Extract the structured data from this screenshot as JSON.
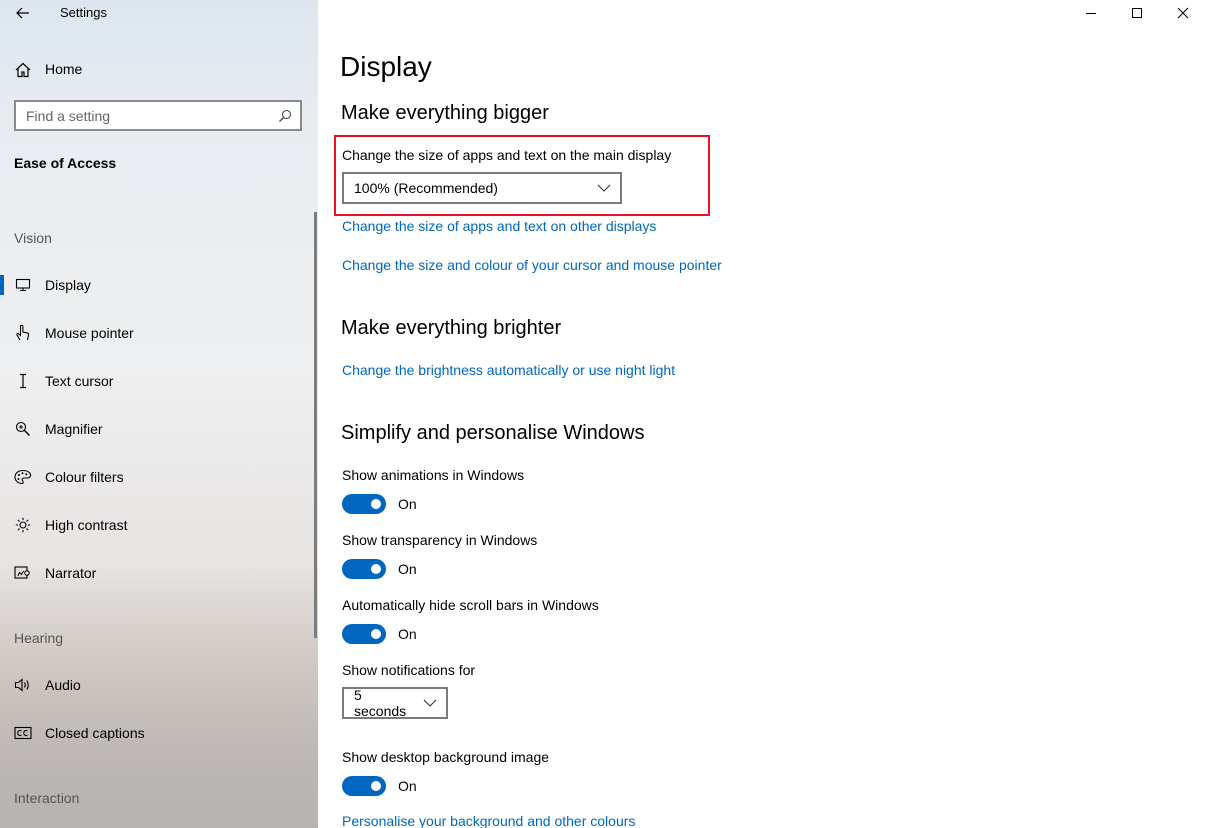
{
  "window": {
    "app_title": "Settings",
    "controls": [
      "minimize",
      "maximize",
      "close"
    ]
  },
  "sidebar": {
    "home_label": "Home",
    "search": {
      "placeholder": "Find a setting",
      "value": ""
    },
    "section_title": "Ease of Access",
    "groups": {
      "vision": "Vision",
      "hearing": "Hearing",
      "interaction": "Interaction"
    },
    "items": [
      {
        "label": "Display",
        "icon": "monitor-icon",
        "selected": true
      },
      {
        "label": "Mouse pointer",
        "icon": "mouse-pointer-icon"
      },
      {
        "label": "Text cursor",
        "icon": "text-cursor-icon"
      },
      {
        "label": "Magnifier",
        "icon": "magnifier-icon"
      },
      {
        "label": "Colour filters",
        "icon": "colour-filters-icon"
      },
      {
        "label": "High contrast",
        "icon": "high-contrast-icon"
      },
      {
        "label": "Narrator",
        "icon": "narrator-icon"
      },
      {
        "label": "Audio",
        "icon": "audio-icon"
      },
      {
        "label": "Closed captions",
        "icon": "closed-captions-icon"
      }
    ]
  },
  "main": {
    "title": "Display",
    "bigger": {
      "heading": "Make everything bigger",
      "size_label": "Change the size of apps and text on the main display",
      "size_value": "100% (Recommended)",
      "link_other_displays": "Change the size of apps and text on other displays",
      "link_cursor": "Change the size and colour of your cursor and mouse pointer"
    },
    "brighter": {
      "heading": "Make everything brighter",
      "link_brightness": "Change the brightness automatically or use night light"
    },
    "simplify": {
      "heading": "Simplify and personalise Windows",
      "animations_label": "Show animations in Windows",
      "animations_state": "On",
      "transparency_label": "Show transparency in Windows",
      "transparency_state": "On",
      "scrollbars_label": "Automatically hide scroll bars in Windows",
      "scrollbars_state": "On",
      "notifications_label": "Show notifications for",
      "notifications_value": "5 seconds",
      "background_label": "Show desktop background image",
      "background_state": "On",
      "link_personalise": "Personalise your background and other colours"
    }
  },
  "colors": {
    "accent": "#0067c0",
    "highlight_border": "#e81123"
  }
}
